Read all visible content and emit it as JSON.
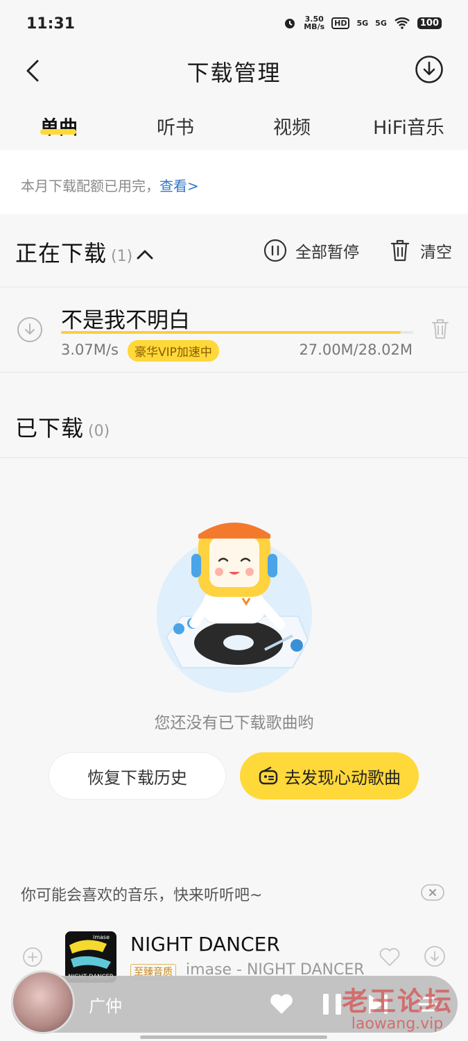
{
  "status_bar": {
    "time": "11:31",
    "net_speed_top": "3.50",
    "net_speed_bottom": "MB/s",
    "hd": "HD",
    "signal1": "5G",
    "signal2": "5G",
    "battery": "100"
  },
  "header": {
    "title": "下载管理"
  },
  "tabs": [
    {
      "label": "单曲",
      "active": true
    },
    {
      "label": "听书",
      "active": false
    },
    {
      "label": "视频",
      "active": false
    },
    {
      "label": "HiFi音乐",
      "active": false
    }
  ],
  "quota": {
    "text": "本月下载配额已用完，",
    "link": "查看>"
  },
  "downloading": {
    "title": "正在下载",
    "count": "(1)",
    "pause_all": "全部暂停",
    "clear": "清空",
    "item": {
      "title": "不是我不明白",
      "speed": "3.07M/s",
      "badge": "豪华VIP加速中",
      "size": "27.00M/28.02M",
      "progress": 0.964
    }
  },
  "downloaded": {
    "title": "已下载",
    "count": "(0)",
    "empty_text": "您还没有已下载歌曲哟",
    "restore_button": "恢复下载历史",
    "discover_button": "去发现心动歌曲"
  },
  "recommend": {
    "title": "你可能会喜欢的音乐，快来听听吧~",
    "song": "NIGHT DANCER",
    "quality_badge": "至臻音质",
    "artist_line": "imase - NIGHT DANCER",
    "cover_text": "NIGHT DANCER",
    "cover_brand": "imase"
  },
  "player": {
    "artist": "广仲"
  },
  "watermark": {
    "line1": "老王论坛",
    "line2": "laowang.vip"
  },
  "colors": {
    "accent": "#ffd83a",
    "link": "#3277c8"
  }
}
